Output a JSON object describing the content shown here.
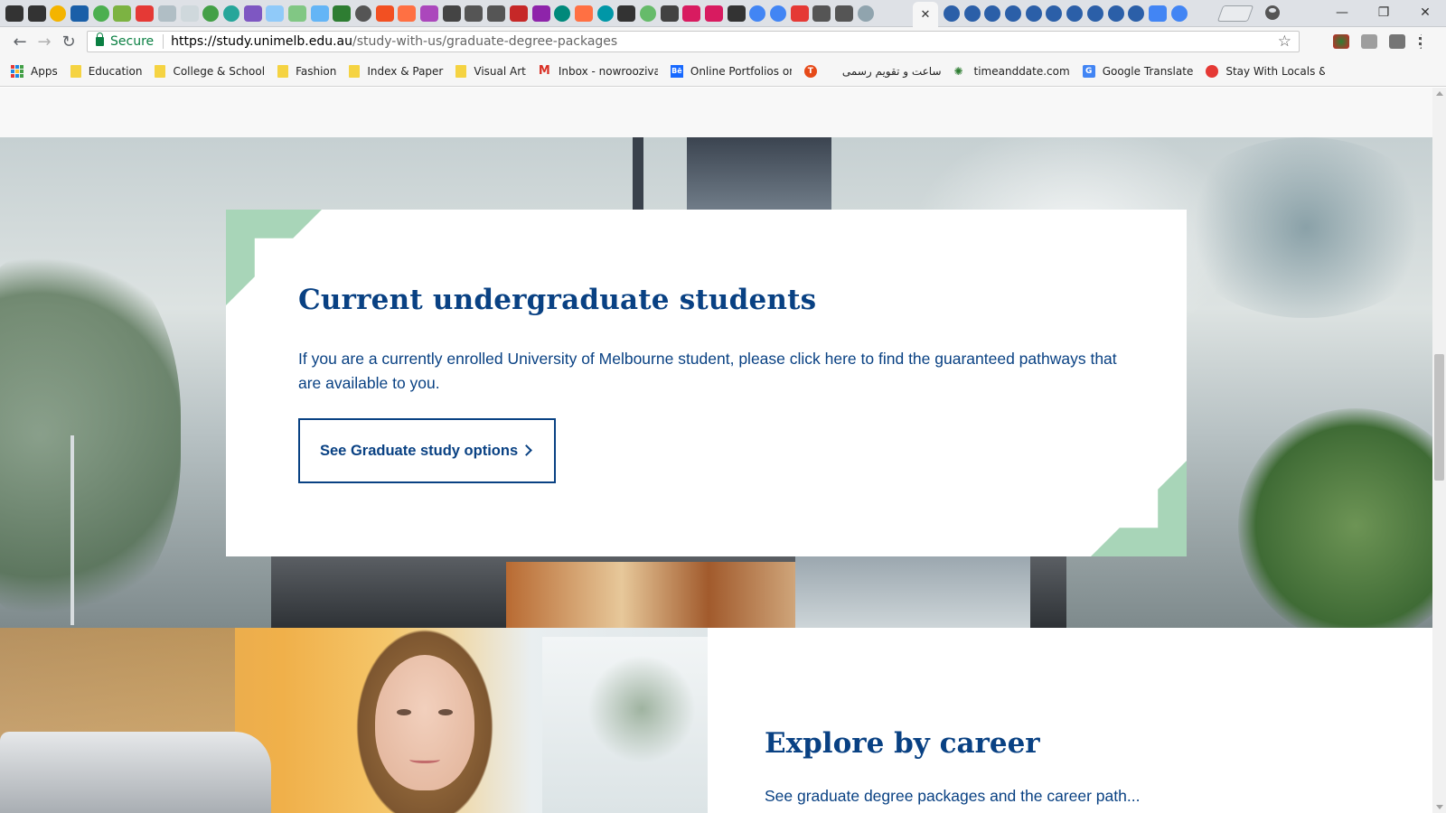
{
  "browser": {
    "url_host": "https://study.unimelb.edu.au",
    "url_path": "/study-with-us/graduate-degree-packages",
    "secure_label": "Secure",
    "tab_close": "✕",
    "window_controls": {
      "minimize": "—",
      "restore": "❐",
      "close": "✕"
    }
  },
  "bookmarks": [
    {
      "label": "Apps",
      "icon": "apps-grid-icon"
    },
    {
      "label": "Education",
      "icon": "folder-icon"
    },
    {
      "label": "College & School",
      "icon": "folder-icon"
    },
    {
      "label": "Fashion",
      "icon": "folder-icon"
    },
    {
      "label": "Index & Paper",
      "icon": "folder-icon"
    },
    {
      "label": "Visual Art",
      "icon": "folder-icon"
    },
    {
      "label": "Inbox - nowroozivahi",
      "icon": "gmail-icon"
    },
    {
      "label": "Online Portfolios on B",
      "icon": "behance-icon"
    },
    {
      "label": "",
      "icon": "t-icon"
    },
    {
      "label": "ساعت و تقویم رسمی",
      "icon": "folder-icon"
    },
    {
      "label": "timeanddate.com",
      "icon": "timeanddate-icon"
    },
    {
      "label": "Google Translate",
      "icon": "translate-icon"
    },
    {
      "label": "Stay With Locals & M",
      "icon": "airbnb-icon"
    }
  ],
  "hero_card": {
    "title": "Current undergraduate students",
    "body": "If you are a currently enrolled University of Melbourne student, please click here to find the guaranteed pathways that are available to you.",
    "button_label": "See Graduate study options"
  },
  "explore": {
    "title": "Explore by career",
    "subtitle": "See graduate degree packages and the career path..."
  },
  "colors": {
    "brand_navy": "#094183",
    "accent_mint": "#a8d5b8",
    "secure_green": "#0b8043"
  },
  "icons": {
    "back": "←",
    "forward": "→",
    "reload": "↻",
    "star": "☆"
  }
}
